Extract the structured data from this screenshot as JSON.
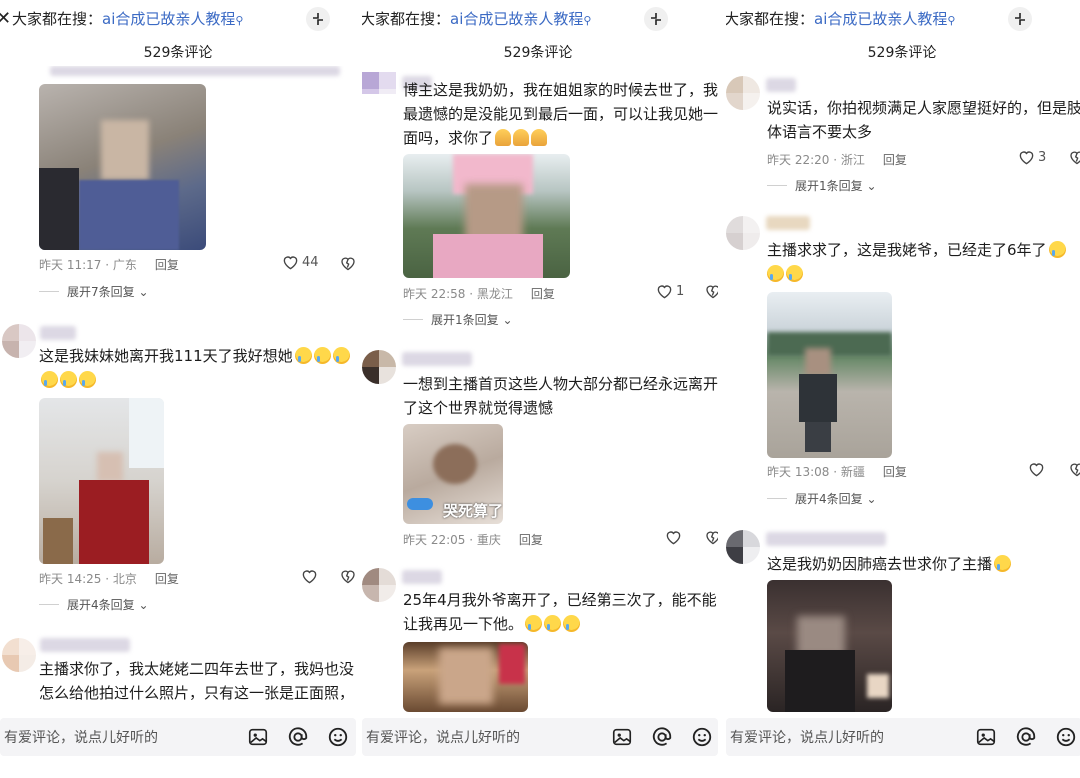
{
  "header": {
    "close_glyph": "✕",
    "search_prefix": "大家都在搜：",
    "search_query": "ai合成已故亲人教程",
    "search_icon_glyph": "⚲",
    "comment_count": "529条评论"
  },
  "footer": {
    "input_placeholder": "有爱评论，说点儿好听的",
    "icons": [
      "image-icon",
      "at-icon",
      "emoji-icon"
    ]
  },
  "colors": {
    "link": "#3b6ac4",
    "meta": "#8a8a8a",
    "bar_bg": "#f4f4f6"
  },
  "panels": [
    {
      "comments": [
        {
          "meta": "昨天 11:17 · 广东",
          "reply": "回复",
          "likes": "44",
          "expand": "展开7条回复"
        },
        {
          "text": "这是我妹妹她离开我111天了我好想她",
          "meta": "昨天 14:25 · 北京",
          "reply": "回复",
          "likes": "",
          "expand": "展开4条回复"
        },
        {
          "text1": "主播求你了，我太姥姥二四年去世了，我妈也没",
          "text2": "怎么给他拍过什么照片，只有这一张是正面照，"
        }
      ]
    },
    {
      "comments": [
        {
          "text1": "博主这是我奶奶，我在姐姐家的时候去世了，我",
          "text2": "最遗憾的是没能见到最后一面，可以让我见她一",
          "text3": "面吗，求你了",
          "meta": "昨天 22:58 · 黑龙江",
          "reply": "回复",
          "likes": "1",
          "expand": "展开1条回复"
        },
        {
          "text1": "一想到主播首页这些人物大部分都已经永远离开",
          "text2": "了这个世界就觉得遗憾",
          "sticker_caption": "哭死算了",
          "meta": "昨天 22:05 · 重庆",
          "reply": "回复",
          "likes": ""
        },
        {
          "text1": "25年4月我外爷离开了，已经第三次了，能不能",
          "text2": "让我再见一下他。"
        }
      ]
    },
    {
      "comments": [
        {
          "text1": "说实话，你拍视频满足人家愿望挺好的，但是肢",
          "text2": "体语言不要太多",
          "meta": "昨天 22:20 · 浙江",
          "reply": "回复",
          "likes": "3",
          "expand": "展开1条回复"
        },
        {
          "text": "主播求求了，这是我姥爷，已经走了6年了",
          "meta": "昨天 13:08 · 新疆",
          "reply": "回复",
          "likes": "",
          "expand": "展开4条回复"
        },
        {
          "text": "这是我奶奶因肺癌去世求你了主播"
        }
      ]
    }
  ]
}
